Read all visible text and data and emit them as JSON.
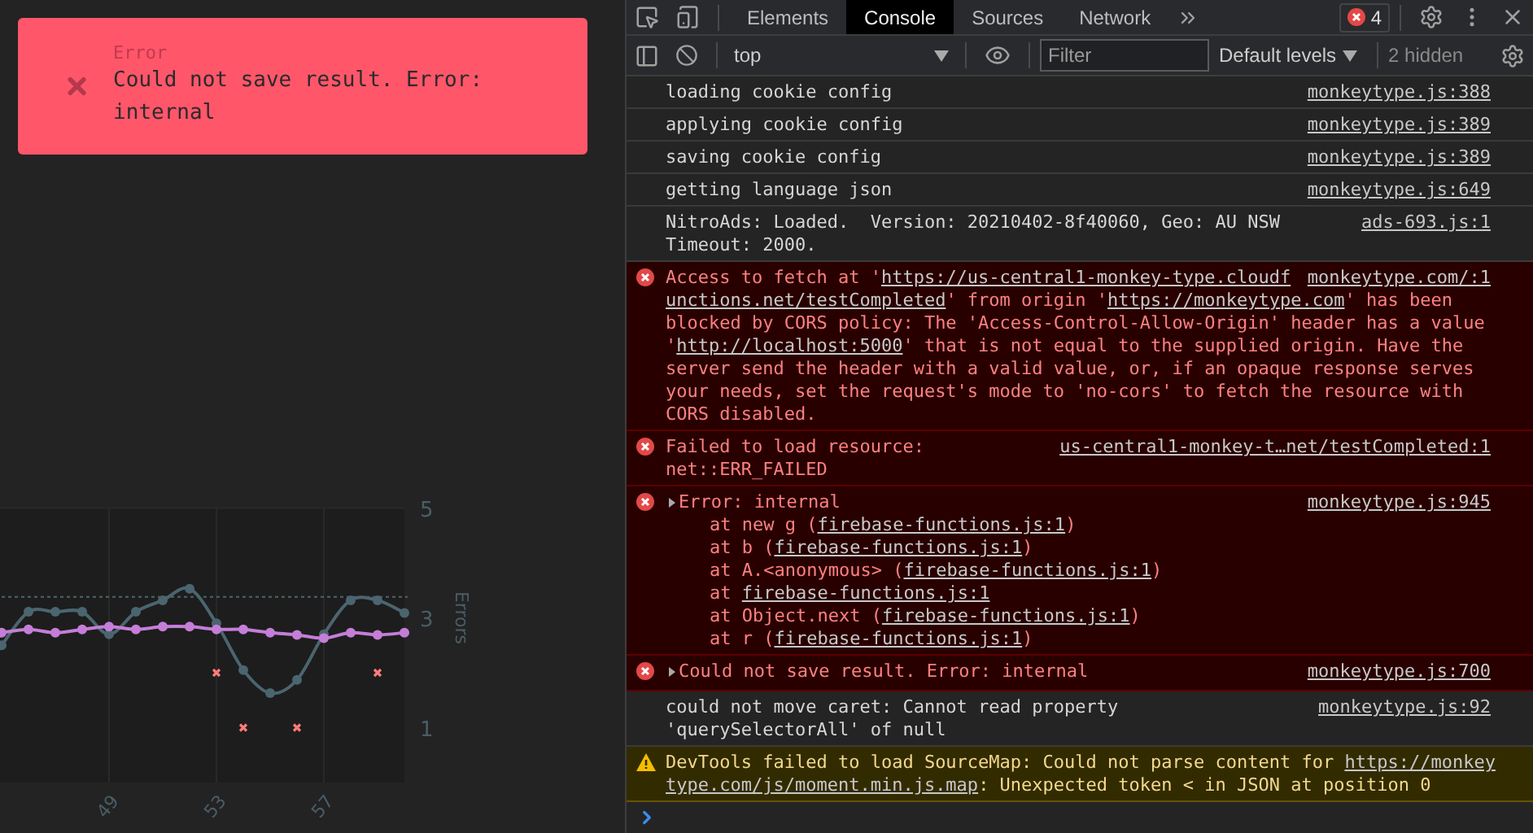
{
  "toast": {
    "title": "Error",
    "message": "Could not save result. Error: internal"
  },
  "chart": {
    "chart_data": {
      "type": "line",
      "ylabel": "Errors",
      "x": [
        45,
        46,
        47,
        48,
        49,
        50,
        51,
        52,
        53,
        54,
        55,
        56,
        57,
        58,
        59,
        60
      ],
      "series": [
        {
          "marker": "circle",
          "color": "#4b6570",
          "values": [
            2.5,
            3.11,
            3.11,
            3.11,
            2.7,
            3.11,
            3.32,
            3.53,
            2.9,
            2.05,
            1.63,
            1.87,
            2.7,
            3.32,
            3.32,
            3.09
          ]
        },
        {
          "marker": "circle",
          "color": "#c47ed8",
          "values": [
            2.73,
            2.79,
            2.73,
            2.79,
            2.84,
            2.79,
            2.84,
            2.84,
            2.79,
            2.79,
            2.73,
            2.69,
            2.63,
            2.73,
            2.69,
            2.73
          ]
        },
        {
          "type": "scatter",
          "marker": "x",
          "color": "#ff7b7b",
          "values": [
            null,
            null,
            null,
            null,
            null,
            null,
            null,
            null,
            2,
            1,
            null,
            1,
            null,
            null,
            2,
            null
          ]
        }
      ],
      "ref_lines": [
        {
          "axis": "y",
          "value": 3.38,
          "color": "#4b6570"
        }
      ],
      "grid": true,
      "xticks": [
        49,
        53,
        57
      ],
      "yticks": [
        1,
        3,
        5
      ],
      "xlim": [
        45,
        60
      ],
      "ylim": [
        0,
        5
      ]
    }
  },
  "devtools": {
    "tabs": [
      {
        "label": "Elements",
        "selected": false
      },
      {
        "label": "Console",
        "selected": true
      },
      {
        "label": "Sources",
        "selected": false
      },
      {
        "label": "Network",
        "selected": false
      }
    ],
    "error_count": "4",
    "context": "top",
    "filter": {
      "placeholder": "Filter"
    },
    "levels": "Default levels",
    "hidden": "2 hidden",
    "messages": [
      {
        "kind": "info",
        "lines": [
          [
            {
              "text": "loading cookie config",
              "link": false
            }
          ]
        ],
        "source": "monkeytype.js:388"
      },
      {
        "kind": "info",
        "lines": [
          [
            {
              "text": "applying cookie config",
              "link": false
            }
          ]
        ],
        "source": "monkeytype.js:389"
      },
      {
        "kind": "info",
        "lines": [
          [
            {
              "text": "saving cookie config",
              "link": false
            }
          ]
        ],
        "source": "monkeytype.js:389"
      },
      {
        "kind": "info",
        "lines": [
          [
            {
              "text": "getting language json",
              "link": false
            }
          ]
        ],
        "source": "monkeytype.js:649"
      },
      {
        "kind": "info",
        "lines": [
          [
            {
              "text": "NitroAds: Loaded.  Version: 20210402-8f40060, Geo: AU NSW",
              "link": false
            }
          ],
          [
            {
              "text": "Timeout: 2000.",
              "link": false
            }
          ]
        ],
        "source": "ads-693.js:1"
      },
      {
        "kind": "error",
        "lines": [
          [
            {
              "text": "Access to fetch at '",
              "link": false
            },
            {
              "text": "https://us-central1-monkey-type.cloudf",
              "link": true
            }
          ],
          [
            {
              "text": "unctions.net/testCompleted",
              "link": true
            },
            {
              "text": "' from origin '",
              "link": false
            },
            {
              "text": "https://monkeytype.com",
              "link": true
            },
            {
              "text": "' has been",
              "link": false
            }
          ],
          [
            {
              "text": "blocked by CORS policy: The 'Access-Control-Allow-Origin' header has a value",
              "link": false
            }
          ],
          [
            {
              "text": "'",
              "link": false
            },
            {
              "text": "http://localhost:5000",
              "link": true
            },
            {
              "text": "' that is not equal to the supplied origin. Have the",
              "link": false
            }
          ],
          [
            {
              "text": "server send the header with a valid value, or, if an opaque response serves",
              "link": false
            }
          ],
          [
            {
              "text": "your needs, set the request's mode to 'no-cors' to fetch the resource with",
              "link": false
            }
          ],
          [
            {
              "text": "CORS disabled.",
              "link": false
            }
          ]
        ],
        "source": "monkeytype.com/:1"
      },
      {
        "kind": "error",
        "lines": [
          [
            {
              "text": "Failed to load resource:",
              "link": false
            }
          ],
          [
            {
              "text": "net::ERR_FAILED",
              "link": false
            }
          ]
        ],
        "source": "us-central1-monkey-t…net/testCompleted:1"
      },
      {
        "kind": "error",
        "collapsed": true,
        "lines": [
          [
            {
              "text": "Error: internal",
              "link": false
            }
          ]
        ],
        "stack": [
          [
            {
              "text": "at new g (",
              "link": false
            },
            {
              "text": "firebase-functions.js:1",
              "link": true
            },
            {
              "text": ")",
              "link": false
            }
          ],
          [
            {
              "text": "at b (",
              "link": false
            },
            {
              "text": "firebase-functions.js:1",
              "link": true
            },
            {
              "text": ")",
              "link": false
            }
          ],
          [
            {
              "text": "at A.<anonymous> (",
              "link": false
            },
            {
              "text": "firebase-functions.js:1",
              "link": true
            },
            {
              "text": ")",
              "link": false
            }
          ],
          [
            {
              "text": "at ",
              "link": false
            },
            {
              "text": "firebase-functions.js:1",
              "link": true
            }
          ],
          [
            {
              "text": "at Object.next (",
              "link": false
            },
            {
              "text": "firebase-functions.js:1",
              "link": true
            },
            {
              "text": ")",
              "link": false
            }
          ],
          [
            {
              "text": "at r (",
              "link": false
            },
            {
              "text": "firebase-functions.js:1",
              "link": true
            },
            {
              "text": ")",
              "link": false
            }
          ]
        ],
        "source": "monkeytype.js:945"
      },
      {
        "kind": "error",
        "collapsed": true,
        "lines": [
          [
            {
              "text": "Could not save result. Error: internal",
              "link": false
            }
          ]
        ],
        "source": "monkeytype.js:700"
      },
      {
        "kind": "info",
        "lines": [
          [
            {
              "text": "could not move caret: Cannot read property",
              "link": false
            }
          ],
          [
            {
              "text": "'querySelectorAll' of null",
              "link": false
            }
          ]
        ],
        "source": "monkeytype.js:92"
      },
      {
        "kind": "warning",
        "lines": [
          [
            {
              "text": "DevTools failed to load SourceMap: Could not parse content for ",
              "link": false
            },
            {
              "text": "https://monkey",
              "link": true
            }
          ],
          [
            {
              "text": "type.com/js/moment.min.js.map",
              "link": true
            },
            {
              "text": ": Unexpected token < in JSON at position 0",
              "link": false
            }
          ]
        ]
      }
    ]
  }
}
